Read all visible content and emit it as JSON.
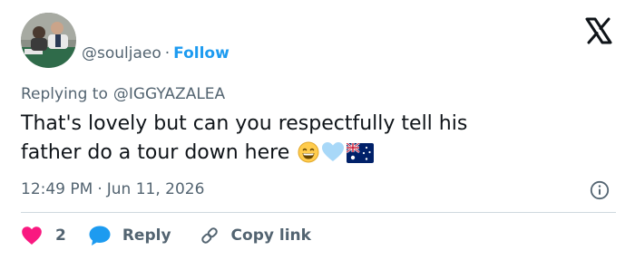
{
  "author": {
    "display_name": "",
    "handle": "@souljaeo",
    "separator": "·",
    "follow_label": "Follow"
  },
  "reply_context": {
    "prefix": "Replying to",
    "mention": "@IGGYAZALEA"
  },
  "tweet": {
    "line1": "That's lovely but can you respectfully tell his",
    "line2": "father do a tour down here",
    "emojis": [
      "grinning-face-emoji",
      "light-blue-heart-emoji",
      "australia-flag-emoji"
    ]
  },
  "meta": {
    "time": "12:49 PM",
    "separator": "·",
    "date": "Jun 11, 2026"
  },
  "actions": {
    "like_count": "2",
    "reply_label": "Reply",
    "copy_label": "Copy link"
  },
  "colors": {
    "accent": "#1d9bf0",
    "like": "#f91880",
    "text": "#0f1419",
    "muted": "#536471",
    "divider": "#cfd9de"
  },
  "icons": [
    "avatar-photo",
    "x-logo-icon",
    "info-icon",
    "heart-icon",
    "reply-bubble-icon",
    "link-icon"
  ]
}
